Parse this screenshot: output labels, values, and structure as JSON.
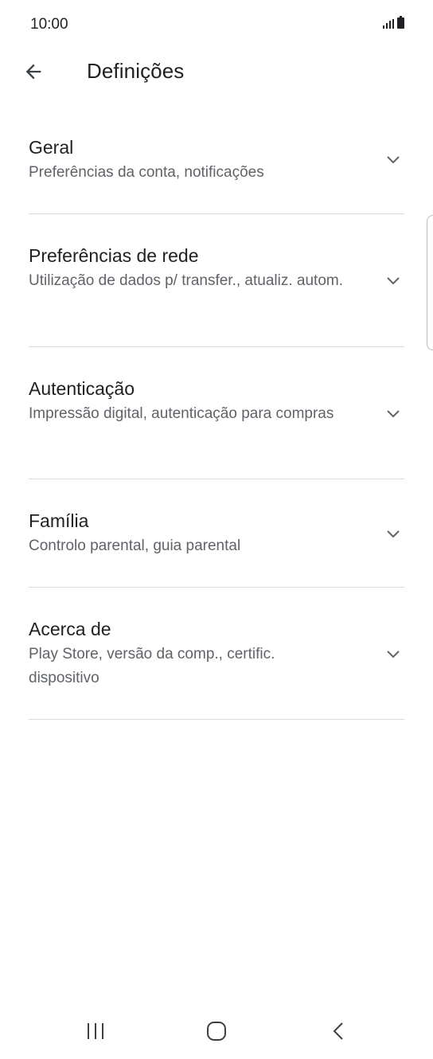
{
  "status_bar": {
    "time": "10:00"
  },
  "header": {
    "title": "Definições",
    "back_icon": "arrow-left-icon"
  },
  "settings": [
    {
      "title": "Geral",
      "subtitle": "Preferências da conta, notificações"
    },
    {
      "title": "Preferências de rede",
      "subtitle": "Utilização de dados p/ transfer., atualiz. autom."
    },
    {
      "title": "Autenticação",
      "subtitle": "Impressão digital, autenticação para compras"
    },
    {
      "title": "Família",
      "subtitle": "Controlo parental, guia parental"
    },
    {
      "title": "Acerca de",
      "subtitle": "Play Store, versão da comp., certific. dispositivo"
    }
  ],
  "nav_bar": {
    "recents_icon": "recents-icon",
    "home_icon": "home-icon",
    "back_icon": "back-chevron-icon"
  },
  "colors": {
    "text_primary": "#202124",
    "text_secondary": "#5f6368",
    "divider": "#dadce0",
    "icon": "#5f6368"
  }
}
